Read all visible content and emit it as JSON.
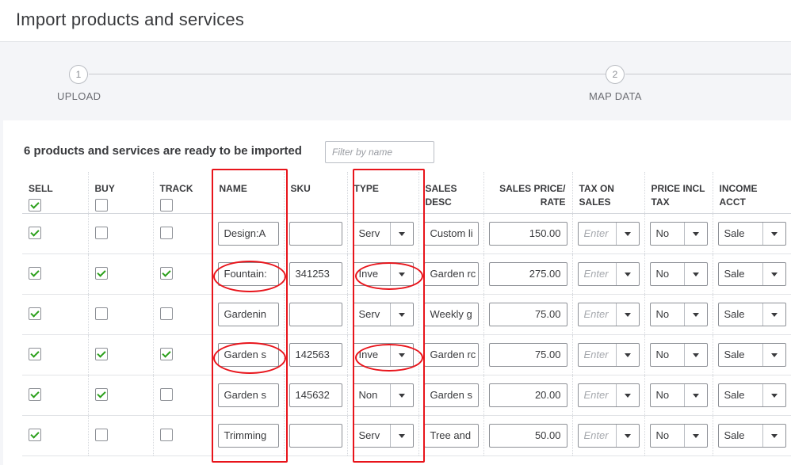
{
  "page": {
    "title": "Import products and services"
  },
  "steps": [
    {
      "number": "1",
      "label": "UPLOAD"
    },
    {
      "number": "2",
      "label": "MAP DATA"
    }
  ],
  "summary": {
    "ready_text": "6 products and services are ready to be imported"
  },
  "filter": {
    "placeholder": "Filter by name"
  },
  "columns": {
    "sell": "SELL",
    "buy": "BUY",
    "track": "TRACK",
    "name": "NAME",
    "sku": "SKU",
    "type": "TYPE",
    "sales_desc": "SALES DESC",
    "sales_price": "SALES PRICE/ RATE",
    "tax_on_sales": "TAX ON SALES",
    "price_incl_tax": "PRICE INCL TAX",
    "income_acct": "INCOME ACCT"
  },
  "tax_placeholder": "Enter",
  "rows": [
    {
      "sell": true,
      "buy": false,
      "track": false,
      "name": "Design:A",
      "sku": "",
      "type": "Serv",
      "sales_desc": "Custom li",
      "price": "150.00",
      "price_incl": "No",
      "income": "Sale"
    },
    {
      "sell": true,
      "buy": true,
      "track": true,
      "name": "Fountain:",
      "sku": "341253",
      "type": "Inve",
      "sales_desc": "Garden rc",
      "price": "275.00",
      "price_incl": "No",
      "income": "Sale"
    },
    {
      "sell": true,
      "buy": false,
      "track": false,
      "name": "Gardenin",
      "sku": "",
      "type": "Serv",
      "sales_desc": "Weekly g",
      "price": "75.00",
      "price_incl": "No",
      "income": "Sale"
    },
    {
      "sell": true,
      "buy": true,
      "track": true,
      "name": "Garden s",
      "sku": "142563",
      "type": "Inve",
      "sales_desc": "Garden rc",
      "price": "75.00",
      "price_incl": "No",
      "income": "Sale"
    },
    {
      "sell": true,
      "buy": true,
      "track": false,
      "name": "Garden s",
      "sku": "145632",
      "type": "Non",
      "sales_desc": "Garden s",
      "price": "20.00",
      "price_incl": "No",
      "income": "Sale"
    },
    {
      "sell": true,
      "buy": false,
      "track": false,
      "name": "Trimming",
      "sku": "",
      "type": "Serv",
      "sales_desc": "Tree and",
      "price": "50.00",
      "price_incl": "No",
      "income": "Sale"
    }
  ],
  "colors": {
    "highlight": "#e8141b",
    "check": "#2ca01c"
  }
}
